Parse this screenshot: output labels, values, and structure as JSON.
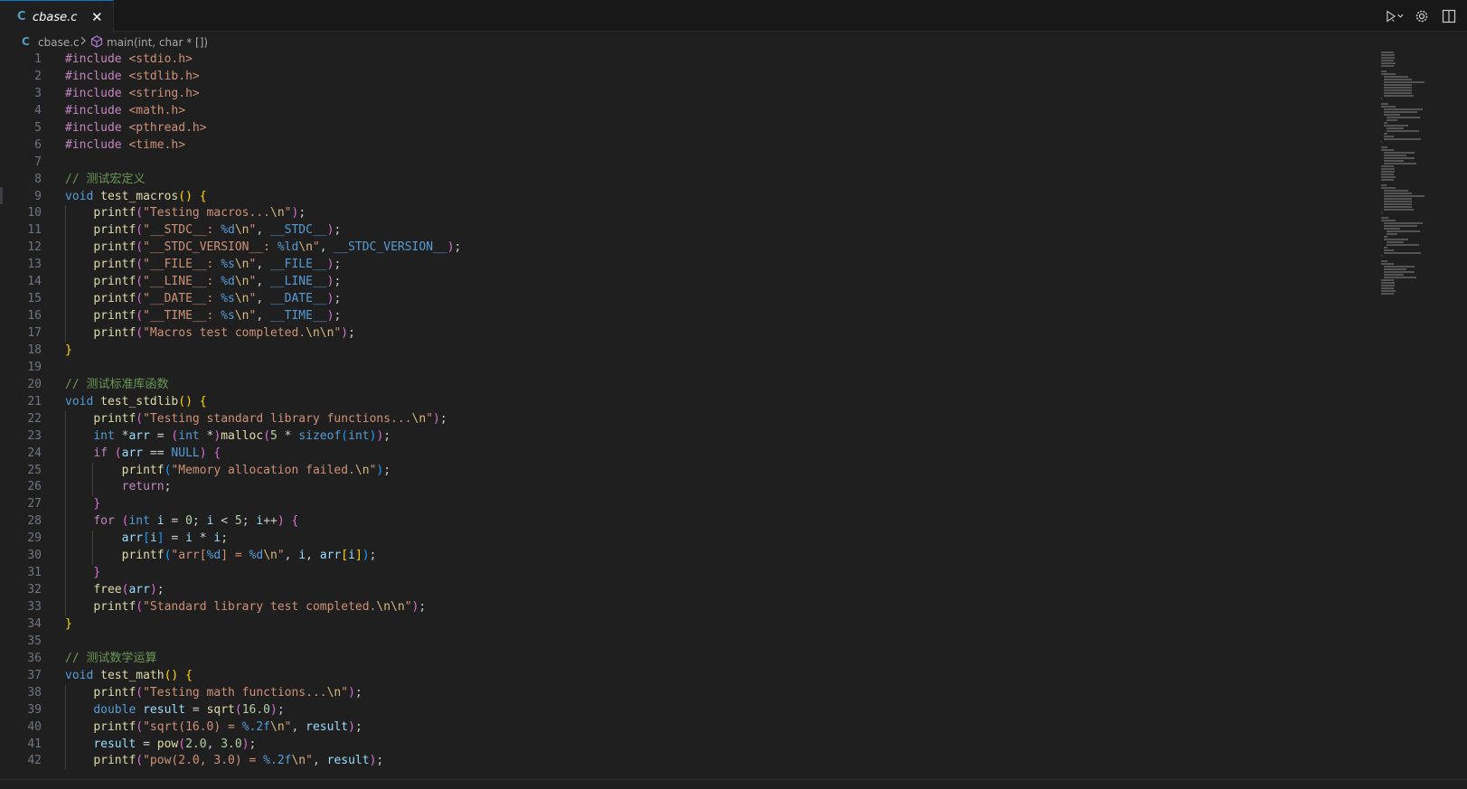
{
  "tab": {
    "lang_icon": "C",
    "filename": "cbase.c",
    "close": "✕"
  },
  "breadcrumb": {
    "lang_icon": "C",
    "file": "cbase.c",
    "symbol": "main(int, char * [])"
  },
  "colors": {
    "keyword": "#c586c0",
    "type": "#569cd6",
    "function": "#dcdcaa",
    "string": "#ce9178",
    "escape": "#d7ba7d",
    "comment": "#6a9955",
    "number": "#b5cea8",
    "variable": "#9cdcfe",
    "bracket1": "#ffd700",
    "bracket2": "#da70d6",
    "bracket3": "#179fff"
  },
  "lines": [
    {
      "n": "1",
      "t": "#include <stdio.h>"
    },
    {
      "n": "2",
      "t": "#include <stdlib.h>"
    },
    {
      "n": "3",
      "t": "#include <string.h>"
    },
    {
      "n": "4",
      "t": "#include <math.h>"
    },
    {
      "n": "5",
      "t": "#include <pthread.h>"
    },
    {
      "n": "6",
      "t": "#include <time.h>"
    },
    {
      "n": "7",
      "t": ""
    },
    {
      "n": "8",
      "t": "// 测试宏定义"
    },
    {
      "n": "9",
      "t": "void test_macros() {"
    },
    {
      "n": "10",
      "t": "    printf(\"Testing macros...\\n\");"
    },
    {
      "n": "11",
      "t": "    printf(\"__STDC__: %d\\n\", __STDC__);"
    },
    {
      "n": "12",
      "t": "    printf(\"__STDC_VERSION__: %ld\\n\", __STDC_VERSION__);"
    },
    {
      "n": "13",
      "t": "    printf(\"__FILE__: %s\\n\", __FILE__);"
    },
    {
      "n": "14",
      "t": "    printf(\"__LINE__: %d\\n\", __LINE__);"
    },
    {
      "n": "15",
      "t": "    printf(\"__DATE__: %s\\n\", __DATE__);"
    },
    {
      "n": "16",
      "t": "    printf(\"__TIME__: %s\\n\", __TIME__);"
    },
    {
      "n": "17",
      "t": "    printf(\"Macros test completed.\\n\\n\");"
    },
    {
      "n": "18",
      "t": "}"
    },
    {
      "n": "19",
      "t": ""
    },
    {
      "n": "20",
      "t": "// 测试标准库函数"
    },
    {
      "n": "21",
      "t": "void test_stdlib() {"
    },
    {
      "n": "22",
      "t": "    printf(\"Testing standard library functions...\\n\");"
    },
    {
      "n": "23",
      "t": "    int *arr = (int *)malloc(5 * sizeof(int));"
    },
    {
      "n": "24",
      "t": "    if (arr == NULL) {"
    },
    {
      "n": "25",
      "t": "        printf(\"Memory allocation failed.\\n\");"
    },
    {
      "n": "26",
      "t": "        return;"
    },
    {
      "n": "27",
      "t": "    }"
    },
    {
      "n": "28",
      "t": "    for (int i = 0; i < 5; i++) {"
    },
    {
      "n": "29",
      "t": "        arr[i] = i * i;"
    },
    {
      "n": "30",
      "t": "        printf(\"arr[%d] = %d\\n\", i, arr[i]);"
    },
    {
      "n": "31",
      "t": "    }"
    },
    {
      "n": "32",
      "t": "    free(arr);"
    },
    {
      "n": "33",
      "t": "    printf(\"Standard library test completed.\\n\\n\");"
    },
    {
      "n": "34",
      "t": "}"
    },
    {
      "n": "35",
      "t": ""
    },
    {
      "n": "36",
      "t": "// 测试数学运算"
    },
    {
      "n": "37",
      "t": "void test_math() {"
    },
    {
      "n": "38",
      "t": "    printf(\"Testing math functions...\\n\");"
    },
    {
      "n": "39",
      "t": "    double result = sqrt(16.0);"
    },
    {
      "n": "40",
      "t": "    printf(\"sqrt(16.0) = %.2f\\n\", result);"
    },
    {
      "n": "41",
      "t": "    result = pow(2.0, 3.0);"
    },
    {
      "n": "42",
      "t": "    printf(\"pow(2.0, 3.0) = %.2f\\n\", result);"
    }
  ]
}
